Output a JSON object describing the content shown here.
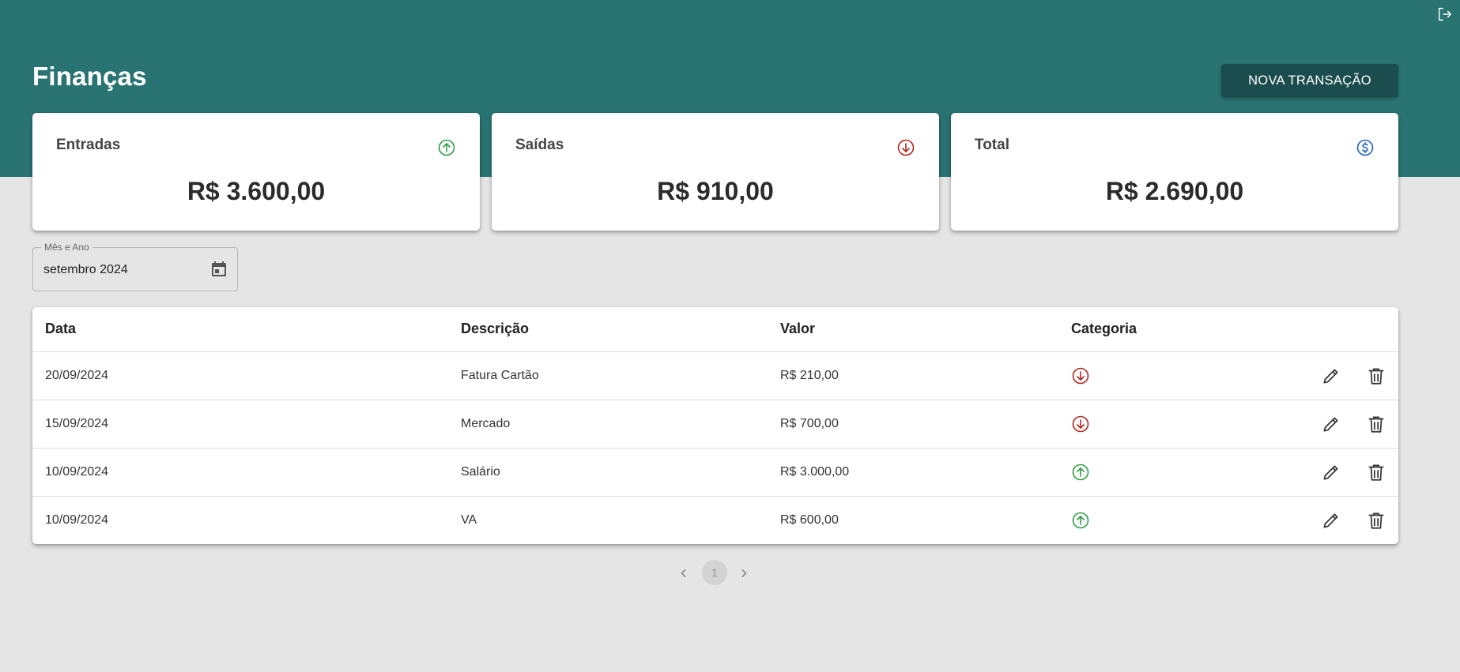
{
  "app": {
    "title": "Finanças",
    "new_transaction_label": "NOVA TRANSAÇÃO",
    "logout_icon": "logout-icon"
  },
  "colors": {
    "header": "#2a7373",
    "button": "#1b4d4f",
    "income": "#2e9e44",
    "expense": "#b3261e",
    "total": "#1f5fbf",
    "background": "#e5e5e5"
  },
  "summary": {
    "income": {
      "label": "Entradas",
      "value": "R$ 3.600,00",
      "icon": "arrow-up-circle-icon"
    },
    "expense": {
      "label": "Saídas",
      "value": "R$ 910,00",
      "icon": "arrow-down-circle-icon"
    },
    "total": {
      "label": "Total",
      "value": "R$ 2.690,00",
      "icon": "dollar-circle-icon"
    }
  },
  "filter": {
    "label": "Mês e Ano",
    "value": "setembro 2024",
    "icon": "calendar-icon"
  },
  "table": {
    "headers": {
      "date": "Data",
      "description": "Descrição",
      "value": "Valor",
      "category": "Categoria"
    },
    "rows": [
      {
        "date": "20/09/2024",
        "description": "Fatura Cartão",
        "value": "R$ 210,00",
        "type": "saida"
      },
      {
        "date": "15/09/2024",
        "description": "Mercado",
        "value": "R$ 700,00",
        "type": "saida"
      },
      {
        "date": "10/09/2024",
        "description": "Salário",
        "value": "R$ 3.000,00",
        "type": "entrada"
      },
      {
        "date": "10/09/2024",
        "description": "VA",
        "value": "R$ 600,00",
        "type": "entrada"
      }
    ],
    "row_actions": [
      "pencil-icon",
      "trash-icon"
    ]
  },
  "pagination": {
    "current_page": "1"
  }
}
